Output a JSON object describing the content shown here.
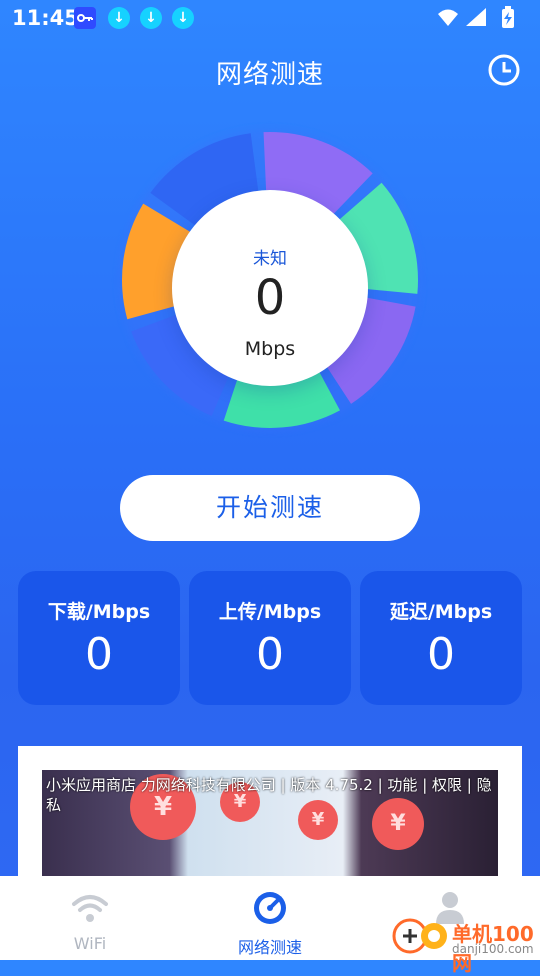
{
  "status_bar": {
    "time": "11:45",
    "notification_icons": [
      "key-icon",
      "download-icon",
      "download-icon",
      "download-icon"
    ],
    "right_icons": [
      "wifi-icon",
      "signal-icon",
      "battery-charging-icon"
    ]
  },
  "header": {
    "title": "网络测速",
    "history_icon": "clock-icon"
  },
  "gauge": {
    "status": "未知",
    "value": "0",
    "unit": "Mbps",
    "segment_colors": [
      "#8f6cf5",
      "#4fe3b3",
      "#8a68f2",
      "#3fe0a9",
      "#3a69f8",
      "#ffa02c",
      "#2f66f3"
    ]
  },
  "actions": {
    "start_label": "开始测速"
  },
  "stats": [
    {
      "label": "下载/Mbps",
      "value": "0"
    },
    {
      "label": "上传/Mbps",
      "value": "0"
    },
    {
      "label": "延迟/Mbps",
      "value": "0"
    }
  ],
  "ad": {
    "text": "小米应用商店 力网络科技有限公司 | 版本 4.75.2 | 功能 | 权限 | 隐私"
  },
  "nav": [
    {
      "label": "WiFi",
      "icon": "wifi-icon",
      "active": false
    },
    {
      "label": "网络测速",
      "icon": "speedometer-icon",
      "active": true
    },
    {
      "label": "",
      "icon": "user-icon",
      "active": false
    }
  ],
  "watermark": {
    "line1": "单机100网",
    "line2": "danji100.com"
  },
  "colors": {
    "accent": "#1b5fe8",
    "card": "#1a56ea",
    "inactive": "#b0b6c0"
  }
}
